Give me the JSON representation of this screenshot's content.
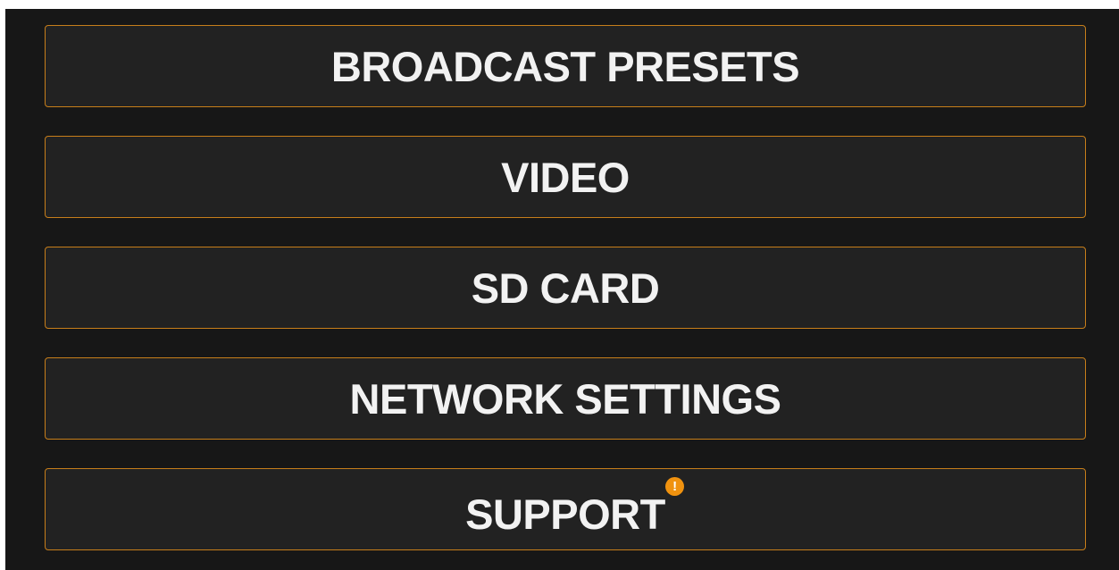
{
  "menu": {
    "items": [
      {
        "label": "BROADCAST PRESETS"
      },
      {
        "label": "VIDEO"
      },
      {
        "label": "SD CARD"
      },
      {
        "label": "NETWORK SETTINGS"
      },
      {
        "label": "SUPPORT",
        "badge": "!"
      }
    ]
  },
  "colors": {
    "background": "#171717",
    "button": "#222222",
    "border": "#c77e1a",
    "text": "#f2f2f2",
    "badge": "#f0920f"
  },
  "icons": {
    "support_badge": "alert-badge-icon"
  }
}
